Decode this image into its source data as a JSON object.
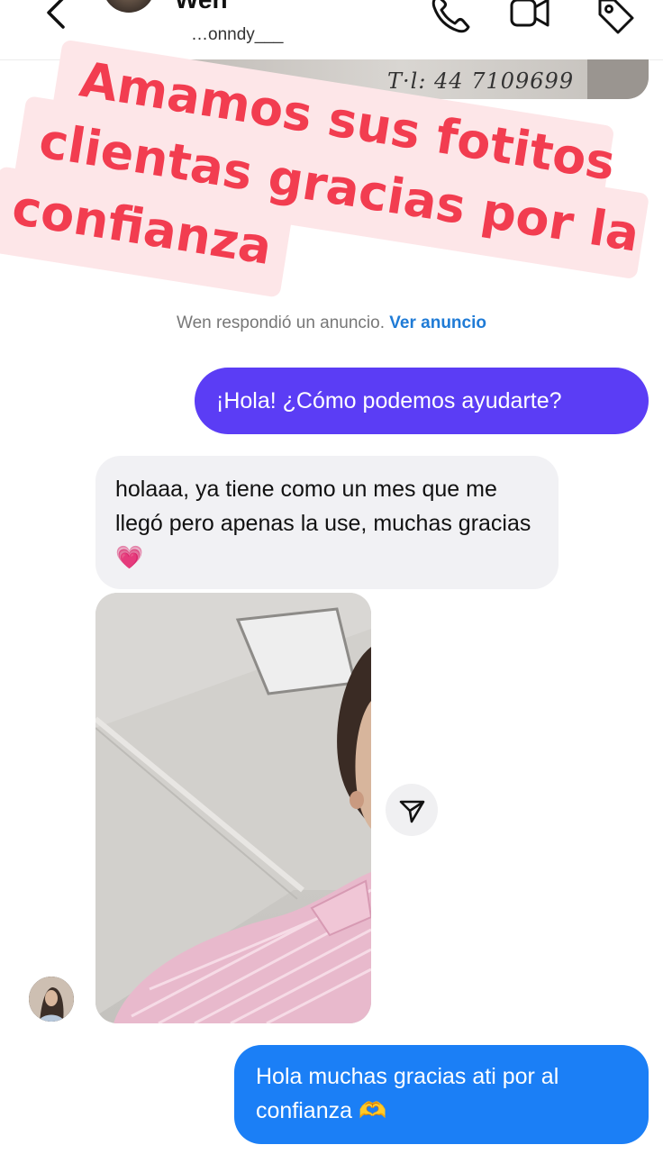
{
  "header": {
    "name": "Wen",
    "handle": "…onndy___"
  },
  "ad": {
    "scribble": "T·l: 44 7109699"
  },
  "promo": {
    "line1": "Amamos sus fotitos",
    "line2": "clientas gracias por la",
    "line3": "confianza",
    "color": "#f23d50",
    "background": "#fde6e8"
  },
  "announcement": {
    "text": "Wen respondió un anuncio.",
    "link": "Ver anuncio"
  },
  "messages": {
    "m1": "¡Hola! ¿Cómo podemos ayudarte?",
    "m2": "holaaa, ya tiene como un mes que me llegó pero apenas la use, muchas gracias 💗",
    "m3": "Hola muchas gracias ati por al confianza 🫶"
  },
  "colors": {
    "outgoing_bubble": "#5b3df5",
    "incoming_bubble": "#f1f1f4",
    "outgoing_blue": "#1b7ff6",
    "link": "#1f7bd6"
  },
  "icons": {
    "back": "chevron-left-icon",
    "call": "phone-icon",
    "video": "video-camera-icon",
    "tag": "tag-icon",
    "share": "send-icon"
  }
}
